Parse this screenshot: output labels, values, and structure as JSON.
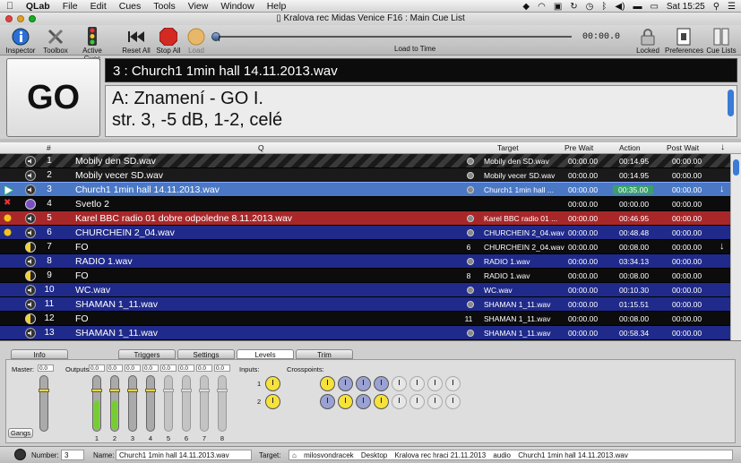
{
  "menubar": {
    "app": "QLab",
    "items": [
      "File",
      "Edit",
      "Cues",
      "Tools",
      "View",
      "Window",
      "Help"
    ],
    "clock": "Sat 15:25"
  },
  "window": {
    "title": "Kralova rec Midas Venice F16 : Main Cue List"
  },
  "toolbar": {
    "inspector": "Inspector",
    "toolbox": "Toolbox",
    "active_cues": "Active Cues",
    "reset_all": "Reset All",
    "stop_all": "Stop All",
    "load": "Load",
    "time": "00:00.0",
    "load_to_time": "Load to Time",
    "locked": "Locked",
    "preferences": "Preferences",
    "cue_lists": "Cue Lists"
  },
  "go": {
    "label": "GO",
    "standby": "3 : Church1 1min hall 14.11.2013.wav",
    "notes_line1": "A: Znamení - GO I.",
    "notes_line2": "str. 3, -5 dB, 1-2, celé"
  },
  "columns": {
    "num": "#",
    "q": "Q",
    "target": "Target",
    "pre_wait": "Pre Wait",
    "action": "Action",
    "post_wait": "Post Wait"
  },
  "cues": [
    {
      "num": "1",
      "name": "Mobily den SD.wav",
      "target": "Mobily den SD.wav",
      "tnum": "",
      "pre": "00:00.00",
      "action": "00:14.95",
      "post": "00:00.00",
      "bg": "#2a2a2a",
      "stripe": true,
      "status": "",
      "icon": "speaker",
      "arrow": ""
    },
    {
      "num": "2",
      "name": "Mobily vecer SD.wav",
      "target": "Mobily vecer SD.wav",
      "tnum": "",
      "pre": "00:00.00",
      "action": "00:14.95",
      "post": "00:00.00",
      "bg": "#1a1a1a",
      "stripe": false,
      "status": "",
      "icon": "speaker",
      "arrow": ""
    },
    {
      "num": "3",
      "name": "Church1 1min hall 14.11.2013.wav",
      "target": "Church1 1min hall ...",
      "tnum": "",
      "pre": "00:00.00",
      "action": "00:35.00",
      "post": "00:00.00",
      "bg": "#4a78c4",
      "stripe": false,
      "status": "play",
      "icon": "speaker",
      "arrow": "↓"
    },
    {
      "num": "4",
      "name": "Svetlo 2",
      "target": "",
      "tnum": "",
      "pre": "00:00.00",
      "action": "00:00.00",
      "post": "00:00.00",
      "bg": "#0c0c0c",
      "stripe": false,
      "status": "error",
      "icon": "network",
      "arrow": ""
    },
    {
      "num": "5",
      "name": "Karel BBC radio 01 dobre odpoledne 8.11.2013.wav",
      "target": "Karel BBC radio 01 ...",
      "tnum": "",
      "pre": "00:00.00",
      "action": "00:46.95",
      "post": "00:00.00",
      "bg": "#a8282a",
      "stripe": false,
      "status": "dot",
      "icon": "speaker",
      "arrow": ""
    },
    {
      "num": "6",
      "name": "CHURCHEIN 2_04.wav",
      "target": "CHURCHEIN 2_04.wav",
      "tnum": "",
      "pre": "00:00.00",
      "action": "00:48.48",
      "post": "00:00.00",
      "bg": "#202a8a",
      "stripe": false,
      "status": "dot",
      "icon": "speaker",
      "arrow": ""
    },
    {
      "num": "7",
      "name": "FO",
      "target": "CHURCHEIN 2_04.wav",
      "tnum": "6",
      "pre": "00:00.00",
      "action": "00:08.00",
      "post": "00:00.00",
      "bg": "#0c0c0c",
      "stripe": false,
      "status": "",
      "icon": "fade",
      "arrow": "↓"
    },
    {
      "num": "8",
      "name": "RADIO 1.wav",
      "target": "RADIO 1.wav",
      "tnum": "",
      "pre": "00:00.00",
      "action": "03:34.13",
      "post": "00:00.00",
      "bg": "#202a8a",
      "stripe": false,
      "status": "",
      "icon": "speaker",
      "arrow": ""
    },
    {
      "num": "9",
      "name": "FO",
      "target": "RADIO 1.wav",
      "tnum": "8",
      "pre": "00:00.00",
      "action": "00:08.00",
      "post": "00:00.00",
      "bg": "#0c0c0c",
      "stripe": false,
      "status": "",
      "icon": "fade",
      "arrow": ""
    },
    {
      "num": "10",
      "name": "WC.wav",
      "target": "WC.wav",
      "tnum": "",
      "pre": "00:00.00",
      "action": "00:10.30",
      "post": "00:00.00",
      "bg": "#202a8a",
      "stripe": false,
      "status": "",
      "icon": "speaker",
      "arrow": ""
    },
    {
      "num": "11",
      "name": "SHAMAN 1_11.wav",
      "target": "SHAMAN 1_11.wav",
      "tnum": "",
      "pre": "00:00.00",
      "action": "01:15.51",
      "post": "00:00.00",
      "bg": "#202a8a",
      "stripe": false,
      "status": "",
      "icon": "speaker",
      "arrow": ""
    },
    {
      "num": "12",
      "name": "FO",
      "target": "SHAMAN 1_11.wav",
      "tnum": "11",
      "pre": "00:00.00",
      "action": "00:08.00",
      "post": "00:00.00",
      "bg": "#0c0c0c",
      "stripe": false,
      "status": "",
      "icon": "fade",
      "arrow": ""
    },
    {
      "num": "13",
      "name": "SHAMAN 1_11.wav",
      "target": "SHAMAN 1_11.wav",
      "tnum": "",
      "pre": "00:00.00",
      "action": "00:58.34",
      "post": "00:00.00",
      "bg": "#202a8a",
      "stripe": false,
      "status": "",
      "icon": "speaker",
      "arrow": ""
    }
  ],
  "inspector": {
    "tabs": [
      "Info",
      "Triggers",
      "Settings",
      "Levels",
      "Trim"
    ],
    "selected_tab": "Levels",
    "master_label": "Master:",
    "outputs_label": "Outputs:",
    "inputs_label": "Inputs:",
    "crosspoints_label": "Crosspoints:",
    "master_value": "0.0",
    "output_values": [
      "0.0",
      "0.0",
      "0.0",
      "0.0",
      "0.0",
      "0.0",
      "0.0",
      "0.0"
    ],
    "channels": [
      "1",
      "2",
      "3",
      "4",
      "5",
      "6",
      "7",
      "8"
    ],
    "output_levels": [
      0.55,
      0.55,
      0,
      0,
      0,
      0,
      0,
      0
    ],
    "inputs": [
      "1",
      "2"
    ],
    "gangs": "Gangs"
  },
  "bottom": {
    "number_label": "Number:",
    "number": "3",
    "name_label": "Name:",
    "name": "Church1 1min hall 14.11.2013.wav",
    "target_label": "Target:",
    "path": [
      "milosvondracek",
      "Desktop",
      "Kralova rec hraci 21.11.2013",
      "audio",
      "Church1 1min hall 14.11.2013.wav"
    ]
  }
}
